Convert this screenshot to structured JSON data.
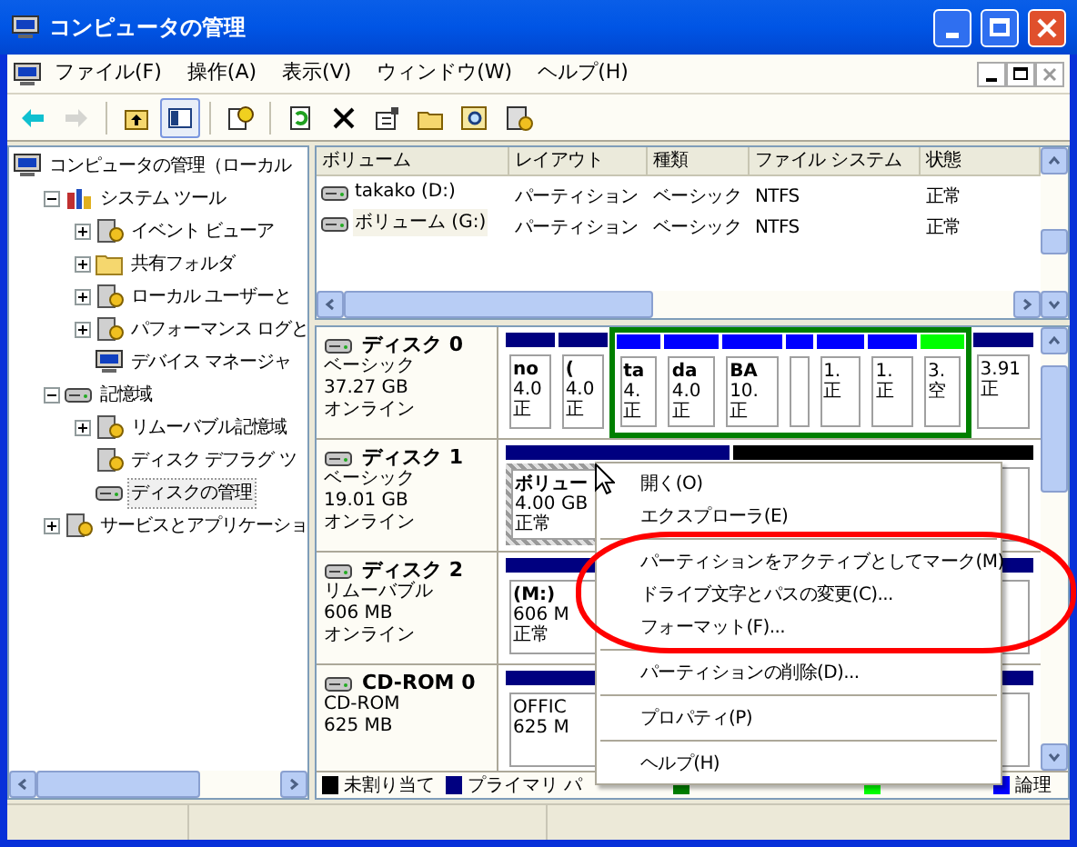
{
  "window": {
    "title": "コンピュータの管理"
  },
  "menu": [
    "ファイル(F)",
    "操作(A)",
    "表示(V)",
    "ウィンドウ(W)",
    "ヘルプ(H)"
  ],
  "toolbar": [
    {
      "disabled": false,
      "pressed": false
    },
    {
      "disabled": true,
      "pressed": false
    },
    {
      "disabled": false,
      "pressed": false
    },
    {
      "disabled": false,
      "pressed": true
    },
    {
      "disabled": false,
      "pressed": false
    },
    {
      "disabled": false,
      "pressed": false
    },
    {
      "disabled": false,
      "pressed": false
    },
    {
      "disabled": false,
      "pressed": false
    },
    {
      "disabled": false,
      "pressed": false
    },
    {
      "disabled": false,
      "pressed": false
    },
    {
      "disabled": false,
      "pressed": false
    }
  ],
  "tree": [
    {
      "label": "コンピュータの管理（ローカル",
      "selected": false,
      "children": [
        {
          "label": "システム ツール",
          "expanded": true,
          "selected": false,
          "children": [
            {
              "label": "イベント ビューア",
              "expanded": false,
              "selected": false
            },
            {
              "label": "共有フォルダ",
              "expanded": false,
              "selected": false
            },
            {
              "label": "ローカル ユーザーと",
              "expanded": false,
              "selected": false
            },
            {
              "label": "パフォーマンス ログと",
              "expanded": false,
              "selected": false
            },
            {
              "label": "デバイス マネージャ",
              "selected": false
            }
          ]
        },
        {
          "label": "記憶域",
          "expanded": true,
          "selected": false,
          "children": [
            {
              "label": "リムーバブル記憶域",
              "expanded": false,
              "selected": false
            },
            {
              "label": "ディスク デフラグ ツ",
              "selected": false
            },
            {
              "label": "ディスクの管理",
              "selected": true
            }
          ]
        },
        {
          "label": "サービスとアプリケーショ",
          "expanded": false,
          "selected": false
        }
      ]
    }
  ],
  "volumes": {
    "columns": [
      "ボリューム",
      "レイアウト",
      "種類",
      "ファイル システム",
      "状態"
    ],
    "rows": [
      {
        "cells": [
          "takako (D:)",
          "パーティション",
          "ベーシック",
          "NTFS",
          "正常"
        ],
        "selected": false
      },
      {
        "cells": [
          "ボリューム (G:)",
          "パーティション",
          "ベーシック",
          "NTFS",
          "正常"
        ],
        "selected": true
      }
    ]
  },
  "disks": [
    {
      "name": "ディスク 0",
      "lines": [
        "ベーシック",
        "37.27 GB",
        "オンライン"
      ],
      "partitions": [
        {
          "kind": "primary",
          "selected": false,
          "lines": [
            "no",
            "4.0",
            "正"
          ]
        },
        {
          "kind": "primary",
          "selected": false,
          "lines": [
            "(",
            "4.0",
            "正"
          ]
        },
        {
          "kind": "logical",
          "selected": false,
          "lines": [
            "ta",
            "4.",
            "正"
          ]
        },
        {
          "kind": "logical",
          "selected": false,
          "lines": [
            "da",
            "4.0",
            "正"
          ]
        },
        {
          "kind": "logical",
          "selected": false,
          "lines": [
            "BA",
            "10.",
            "正"
          ]
        },
        {
          "kind": "logical",
          "selected": false
        },
        {
          "kind": "logical",
          "selected": false,
          "lines": [
            "1.",
            "正"
          ]
        },
        {
          "kind": "logical",
          "selected": false,
          "lines": [
            "1.",
            "正"
          ]
        },
        {
          "kind": "free",
          "selected": false,
          "lines": [
            "3.",
            "空"
          ]
        },
        {
          "kind": "primary",
          "selected": false,
          "lines": [
            "3.91",
            "正"
          ]
        }
      ]
    },
    {
      "name": "ディスク 1",
      "lines": [
        "ベーシック",
        "19.01 GB",
        "オンライン"
      ],
      "partitions": [
        {
          "kind": "primary",
          "selected": true,
          "lines": [
            "ボリュー",
            "4.00 GB",
            "正常"
          ]
        },
        {
          "kind": "unallocated",
          "selected": false
        }
      ]
    },
    {
      "name": "ディスク 2",
      "lines": [
        "リムーバブル",
        "606 MB",
        "オンライン"
      ],
      "partitions": [
        {
          "kind": "primary",
          "selected": false,
          "lines": [
            "(M:)",
            "606 M",
            "正常"
          ]
        }
      ]
    },
    {
      "name": "CD-ROM 0",
      "lines": [
        "CD-ROM",
        "625 MB"
      ],
      "partitions": [
        {
          "kind": "primary",
          "selected": false,
          "lines": [
            "OFFIC",
            "625 M"
          ]
        }
      ]
    }
  ],
  "legend": [
    {
      "label": "未割り当て",
      "color": "#000000"
    },
    {
      "label": "プライマリ パ",
      "color": "#000080"
    },
    {
      "color": "#008000"
    },
    {
      "color": "#00ff00"
    },
    {
      "label": "論理",
      "color": "#0000ff"
    }
  ],
  "context_menu": [
    {
      "kind": "item",
      "label": "開く(O)"
    },
    {
      "kind": "item",
      "label": "エクスプローラ(E)"
    },
    {
      "kind": "separator"
    },
    {
      "kind": "item",
      "label": "パーティションをアクティブとしてマーク(M)"
    },
    {
      "kind": "item",
      "label": "ドライブ文字とパスの変更(C)..."
    },
    {
      "kind": "item",
      "label": "フォーマット(F)..."
    },
    {
      "kind": "separator"
    },
    {
      "kind": "item",
      "label": "パーティションの削除(D)..."
    },
    {
      "kind": "separator"
    },
    {
      "kind": "item",
      "label": "プロパティ(P)"
    },
    {
      "kind": "separator"
    },
    {
      "kind": "item",
      "label": "ヘルプ(H)"
    }
  ]
}
